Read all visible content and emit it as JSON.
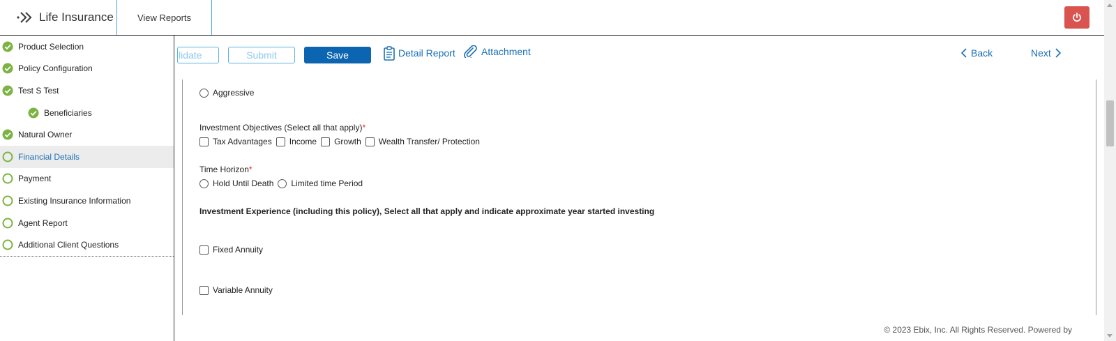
{
  "header": {
    "brand": "Life Insurance",
    "tabs": [
      {
        "label": "View Reports"
      }
    ],
    "power_icon": "power-icon",
    "power_color": "#d9534f"
  },
  "sidebar": {
    "items": [
      {
        "label": "Product Selection",
        "status": "complete"
      },
      {
        "label": "Policy Configuration",
        "status": "complete"
      },
      {
        "label": "Test S Test",
        "status": "complete"
      },
      {
        "label": "Beneficiaries",
        "status": "complete",
        "sub": true
      },
      {
        "label": "Natural Owner",
        "status": "complete"
      },
      {
        "label": "Financial Details",
        "status": "incomplete",
        "active": true
      },
      {
        "label": "Payment",
        "status": "incomplete"
      },
      {
        "label": "Existing Insurance Information",
        "status": "incomplete"
      },
      {
        "label": "Agent Report",
        "status": "incomplete"
      },
      {
        "label": "Additional Client Questions",
        "status": "incomplete"
      }
    ]
  },
  "toolbar": {
    "validate_label": "lidate",
    "submit_label": "Submit",
    "save_label": "Save",
    "detail_report_label": "Detail Report",
    "attachment_label": "Attachment",
    "back_label": "Back",
    "next_label": "Next"
  },
  "form": {
    "risk_option": "Aggressive",
    "objectives_label": "Investment Objectives (Select all that apply)",
    "required_mark": "*",
    "objectives": [
      "Tax Advantages",
      "Income",
      "Growth",
      "Wealth Transfer/ Protection"
    ],
    "time_horizon_label": "Time Horizon",
    "time_horizon_options": [
      "Hold Until Death",
      "Limited time Period"
    ],
    "experience_label": "Investment Experience (including this policy), Select all that apply and indicate approximate year started investing",
    "experience_options": [
      "Fixed Annuity",
      "Variable Annuity"
    ]
  },
  "footer": {
    "text": "© 2023 Ebix, Inc. All Rights Reserved. Powered by"
  },
  "colors": {
    "accent": "#1a6fb5",
    "save_button": "#0c65b0",
    "status_green": "#7cb342",
    "required": "#e02424"
  }
}
